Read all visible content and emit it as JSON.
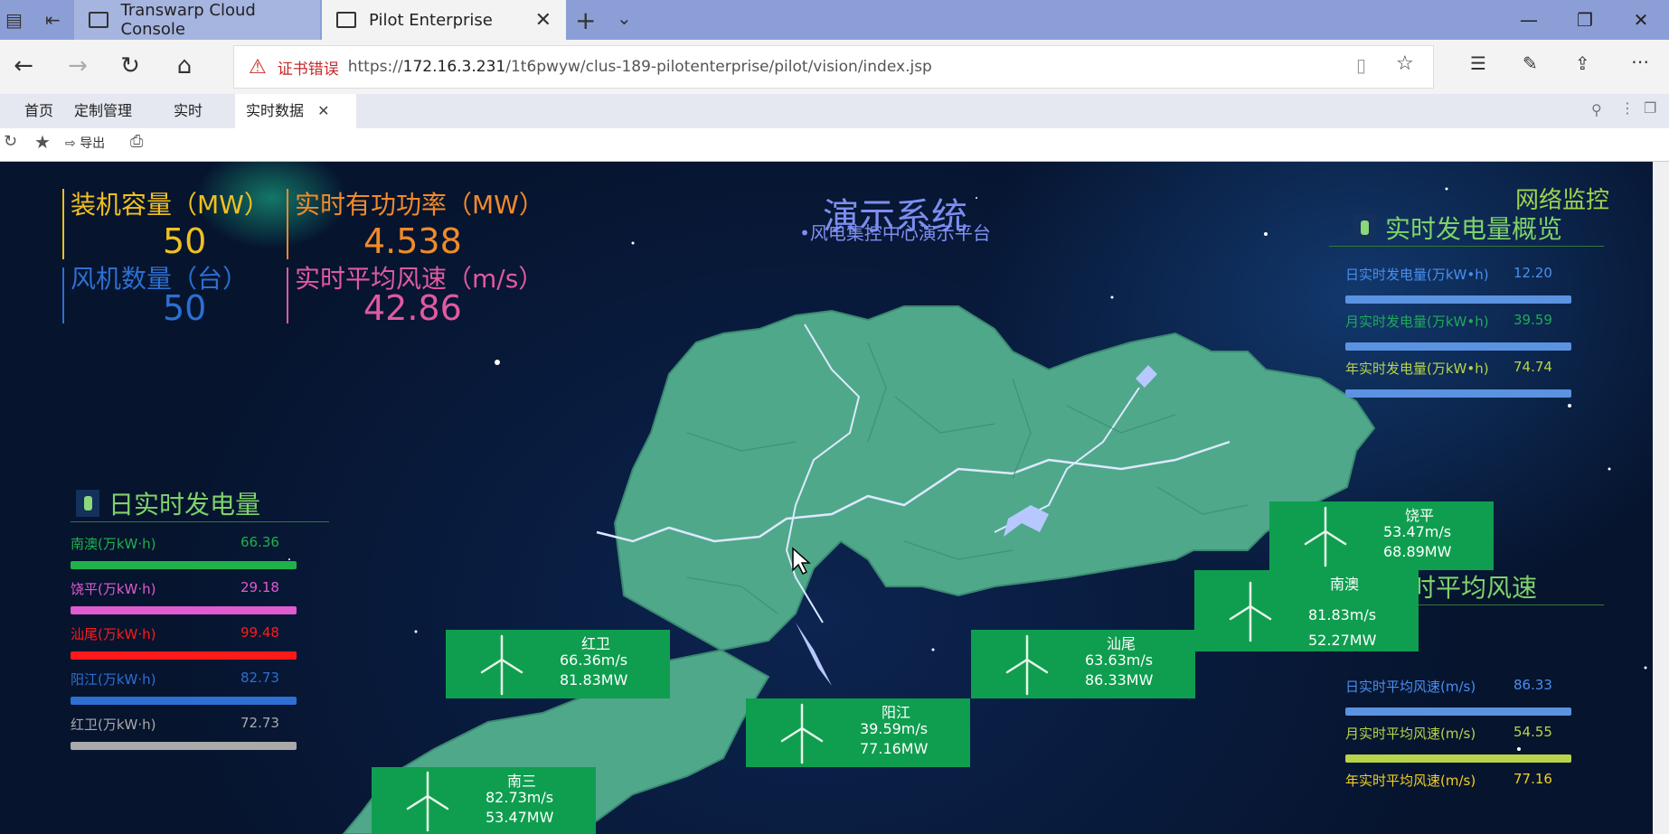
{
  "browser": {
    "tabs": [
      {
        "label": "Transwarp Cloud Console"
      },
      {
        "label": "Pilot Enterprise"
      }
    ],
    "cert_error": "证书错误",
    "url_prefix": "https://",
    "url_host": "172.16.3.231",
    "url_path": "/1t6pwyw/clus-189-pilotenterprise/pilot/vision/index.jsp"
  },
  "app_nav": {
    "items": [
      "首页",
      "定制管理",
      "实时",
      "实时数据"
    ],
    "export_label": "导出"
  },
  "dashboard": {
    "title": "演示系统",
    "subtitle": "风电集控中心演示平台",
    "network_monitor": "网络监控",
    "stats": [
      {
        "label": "装机容量（MW）",
        "value": "50",
        "color": "#f0c020"
      },
      {
        "label": "实时有功功率（MW）",
        "value": "4.538",
        "color": "#f08a2a"
      },
      {
        "label": "风机数量（台）",
        "value": "50",
        "color": "#2d6fd2"
      },
      {
        "label": "实时平均风速（m/s）",
        "value": "42.86",
        "color": "#e05aa0"
      }
    ],
    "daily_gen": {
      "title": "日实时发电量",
      "rows": [
        {
          "label": "南澳(万kW·h)",
          "value": "66.36",
          "fraction": 1.0,
          "color": "#1fb24a"
        },
        {
          "label": "饶平(万kW·h)",
          "value": "29.18",
          "fraction": 1.0,
          "color": "#e05ad0"
        },
        {
          "label": "汕尾(万kW·h)",
          "value": "99.48",
          "fraction": 1.0,
          "color": "#ff1a1a"
        },
        {
          "label": "阳江(万kW·h)",
          "value": "82.73",
          "fraction": 1.0,
          "color": "#2d6fd2"
        },
        {
          "label": "红卫(万kW·h)",
          "value": "72.73",
          "fraction": 1.0,
          "color": "#aaaaaa"
        }
      ]
    },
    "gen_overview": {
      "title": "实时发电量概览",
      "rows": [
        {
          "label": "日实时发电量(万kW•h)",
          "value": "12.20",
          "color": "#4a8ff0",
          "bar_color": "#5b93e0"
        },
        {
          "label": "月实时发电量(万kW•h)",
          "value": "39.59",
          "color": "#1faa5a",
          "bar_color": "#5b93e0"
        },
        {
          "label": "年实时发电量(万kW•h)",
          "value": "74.74",
          "color": "#b7d44a",
          "bar_color": "#5b93e0"
        }
      ]
    },
    "avg_wind": {
      "title": "实时平均风速",
      "rows": [
        {
          "label": "日实时平均风速(m/s)",
          "value": "86.33",
          "color": "#4a8ff0",
          "bar_color": "#5b93e0"
        },
        {
          "label": "月实时平均风速(m/s)",
          "value": "54.55",
          "color": "#b7d44a",
          "bar_color": "#b7d44a"
        },
        {
          "label": "年实时平均风速(m/s)",
          "value": "77.16",
          "color": "#f0d020",
          "bar_color": ""
        }
      ]
    },
    "sites": [
      {
        "name": "饶平",
        "speed": "53.47m/s",
        "power": "68.89MW"
      },
      {
        "name": "南澳",
        "speed": "81.83m/s",
        "power": "52.27MW"
      },
      {
        "name": "红卫",
        "speed": "66.36m/s",
        "power": "81.83MW"
      },
      {
        "name": "汕尾",
        "speed": "63.63m/s",
        "power": "86.33MW"
      },
      {
        "name": "阳江",
        "speed": "39.59m/s",
        "power": "77.16MW"
      },
      {
        "name": "南三",
        "speed": "82.73m/s",
        "power": "53.47MW"
      }
    ]
  }
}
